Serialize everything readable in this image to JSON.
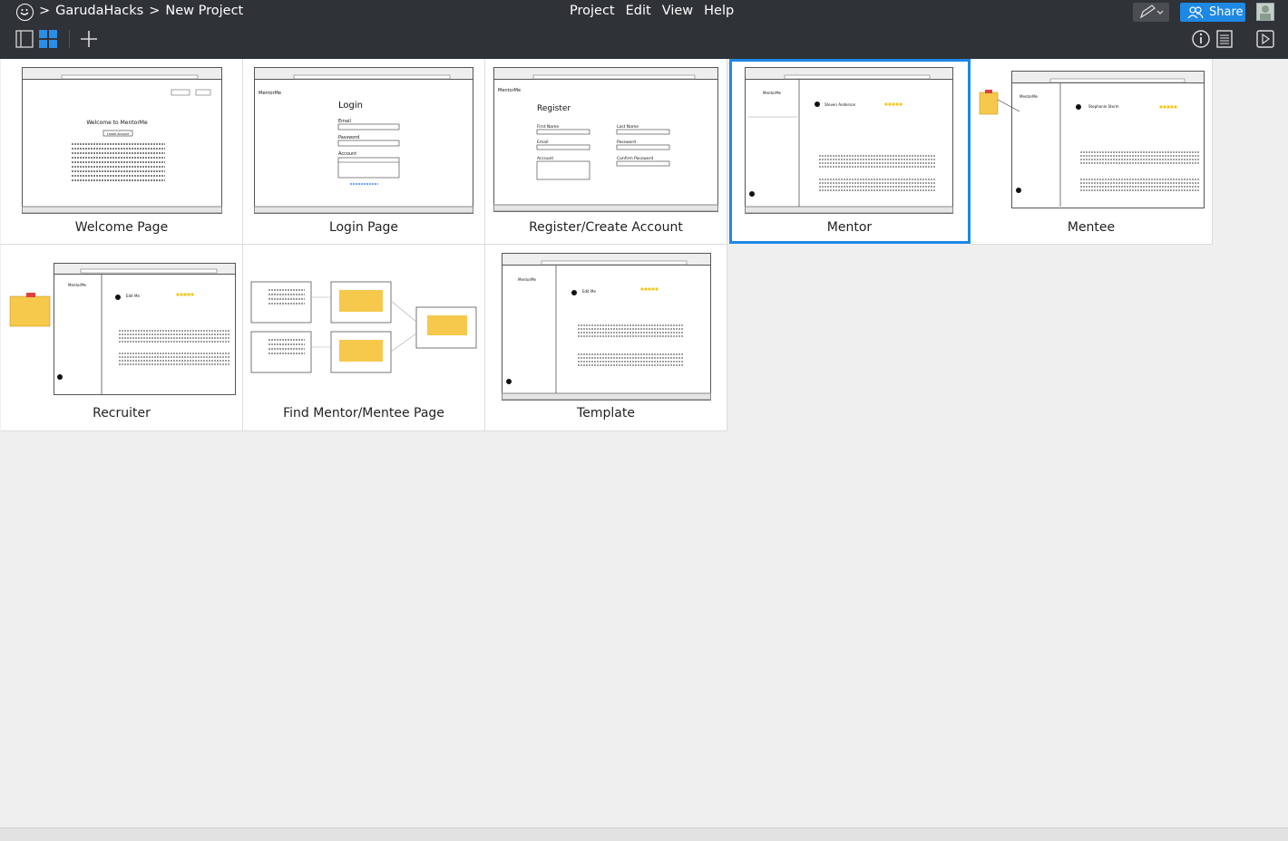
{
  "header": {
    "breadcrumb": [
      ">",
      "GarudaHacks",
      ">",
      "New Project"
    ],
    "menu": [
      "Project",
      "Edit",
      "View",
      "Help"
    ],
    "share_label": "Share"
  },
  "mockups": [
    {
      "label": "Welcome Page",
      "selected": false
    },
    {
      "label": "Login Page",
      "selected": false
    },
    {
      "label": "Register/Create Account",
      "selected": false
    },
    {
      "label": "Mentor",
      "selected": true
    },
    {
      "label": "Mentee",
      "selected": false
    },
    {
      "label": "Recruiter",
      "selected": false
    },
    {
      "label": "Find Mentor/Mentee Page",
      "selected": false
    },
    {
      "label": "Template",
      "selected": false
    }
  ],
  "thumbs": {
    "welcome": {
      "title": "Welcome to MentorMe",
      "button": "Create Account"
    },
    "login": {
      "brand": "MentorMe",
      "title": "Login",
      "email": "Email",
      "password": "Password",
      "account": "Account"
    },
    "register": {
      "brand": "MentorMe",
      "title": "Register",
      "first": "First Name",
      "last": "Last Name",
      "email": "Email",
      "password": "Password",
      "account": "Account",
      "confirm": "Confirm Password"
    },
    "mentor": {
      "brand": "MentorMe",
      "name": "Steven Anderson"
    },
    "mentee": {
      "brand": "MentorMe",
      "name": "Stephanie Storm"
    },
    "recruiter": {
      "brand": "MentorMe",
      "name": "Edit Me"
    },
    "template": {
      "brand": "MentorMe",
      "name": "Edit Me"
    }
  }
}
